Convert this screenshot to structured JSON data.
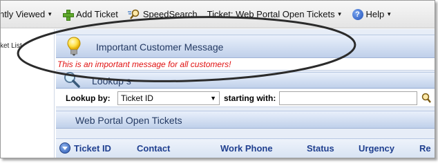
{
  "toolbar": {
    "recently_viewed": "ntly Viewed",
    "add_ticket": "Add Ticket",
    "speedsearch": "SpeedSearch",
    "ticket_view": "Ticket: Web Portal Open Tickets",
    "help": "Help"
  },
  "sidebar": {
    "partial_item": "cket List"
  },
  "announcement": {
    "title": "Important Customer Message",
    "message": "This is an important message for all customers!"
  },
  "lookup": {
    "header": "Lookup s",
    "lookup_by_label": "Lookup by:",
    "lookup_by_value": "Ticket ID",
    "starting_with_label": "starting with:",
    "starting_with_value": ""
  },
  "tickets": {
    "title": "Web Portal Open Tickets",
    "columns": [
      "Ticket ID",
      "Contact",
      "Work Phone",
      "Status",
      "Urgency",
      "Re"
    ]
  },
  "colors": {
    "header_text": "#243a63",
    "column_text": "#1f3f8f",
    "message_text": "#e01010"
  },
  "icons": [
    "plus-icon",
    "speedsearch-icon",
    "help-icon",
    "lightbulb-icon",
    "magnifier-icon",
    "go-search-icon",
    "sort-icon"
  ]
}
